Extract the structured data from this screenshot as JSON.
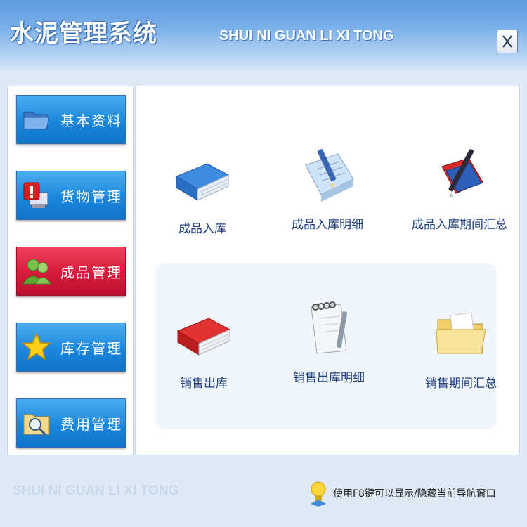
{
  "window": {
    "title": "水泥管理系统",
    "subtitle": "SHUI NI GUAN LI XI TONG",
    "close_label": "X"
  },
  "sidebar": {
    "items": [
      {
        "label": "基本资料",
        "icon": "folder-icon",
        "active": false
      },
      {
        "label": "货物管理",
        "icon": "warning-computer-icon",
        "active": false
      },
      {
        "label": "成品管理",
        "icon": "user-icon",
        "active": true
      },
      {
        "label": "库存管理",
        "icon": "star-icon",
        "active": false
      },
      {
        "label": "费用管理",
        "icon": "magnifier-folder-icon",
        "active": false
      }
    ]
  },
  "main": {
    "top_row": [
      {
        "label": "成品入库",
        "icon": "blue-binder-icon"
      },
      {
        "label": "成品入库明细",
        "icon": "notepad-pen-icon"
      },
      {
        "label": "成品入库期间汇总",
        "icon": "book-pen-icon"
      }
    ],
    "bottom_row": [
      {
        "label": "销售出库",
        "icon": "red-binder-icon"
      },
      {
        "label": "销售出库明细",
        "icon": "spiral-notebook-icon"
      },
      {
        "label": "销售期间汇总",
        "icon": "yellow-folder-icon"
      }
    ]
  },
  "footer": {
    "brand": "SHUI NI GUAN LI XI TONG",
    "hint": "使用F8键可以显示/隐藏当前导航窗口",
    "hint_icon": "lightbulb-icon"
  },
  "colors": {
    "nav_blue": "#1b87dc",
    "nav_active_red": "#d51a3b",
    "label_blue": "#1d3e7f",
    "title_bar": "#5f9be0"
  }
}
